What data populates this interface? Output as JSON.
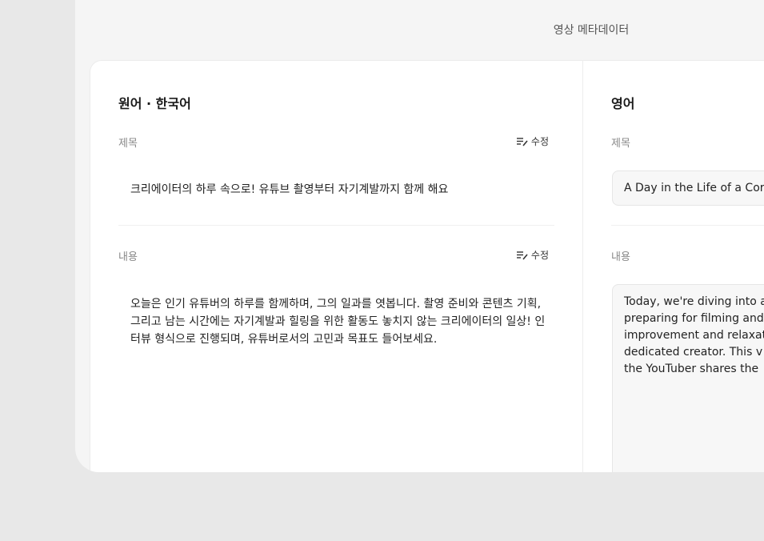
{
  "page": {
    "title": "영상 메타데이터"
  },
  "source": {
    "heading": "원어 · 한국어",
    "title_label": "제목",
    "title_edit_label": "수정",
    "title_value": "크리에이터의 하루 속으로! 유튜브 촬영부터 자기계발까지 함께 해요",
    "content_label": "내용",
    "content_edit_label": "수정",
    "content_value": "오늘은 인기 유튜버의 하루를 함께하며, 그의 일과를 엿봅니다. 촬영 준비와 콘텐츠 기획, 그리고 남는 시간에는 자기계발과 힐링을 위한 활동도 놓치지 않는 크리에이터의 일상! 인터뷰 형식으로 진행되며, 유튜버로서의 고민과 목표도 들어보세요."
  },
  "target": {
    "heading": "영어",
    "title_label": "제목",
    "title_value": "A Day in the Life of a Cor",
    "content_label": "내용",
    "content_value": "Today, we're diving into a\npreparing for filming and\nimprovement and relaxat\ndedicated creator. This v\nthe YouTuber shares the"
  },
  "icons": {
    "edit": "edit-pencil-icon"
  }
}
